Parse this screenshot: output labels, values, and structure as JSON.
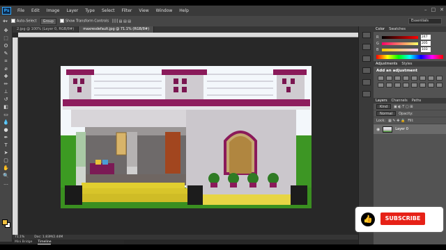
{
  "menubar": {
    "logo": "Ps",
    "items": [
      "File",
      "Edit",
      "Image",
      "Layer",
      "Type",
      "Select",
      "Filter",
      "View",
      "Window",
      "Help"
    ]
  },
  "options": {
    "auto_select_label": "Auto-Select",
    "auto_select_value": "Group",
    "transform_label": "Show Transform Controls",
    "workspace": "Essentials"
  },
  "tabs": [
    {
      "label": "2.jpg @ 100% (Layer 0, RGB/8#)"
    },
    {
      "label": "maxresdefault.jpg @ 71.1% (RGB/8#)"
    }
  ],
  "status": {
    "zoom": "71.1%",
    "doc": "Doc: 1.83M/2.44M"
  },
  "bottom_tabs": [
    "Mini Bridge",
    "Timeline"
  ],
  "color_panel": {
    "tabs": [
      "Color",
      "Swatches"
    ],
    "r": {
      "label": "R",
      "value": "247"
    },
    "g": {
      "label": "G",
      "value": "205"
    },
    "b": {
      "label": "B",
      "value": "103"
    }
  },
  "adjust_panel": {
    "tabs": [
      "Adjustments",
      "Styles"
    ],
    "title": "Add an adjustment"
  },
  "layers_panel": {
    "tabs": [
      "Layers",
      "Channels",
      "Paths"
    ],
    "kind": "Kind",
    "blend": "Normal",
    "opacity_label": "Opacity:",
    "lock_label": "Lock:",
    "fill_label": "Fill:",
    "layer_name": "Layer 0"
  },
  "overlay": {
    "subscribe": "SUBSCRIBE"
  },
  "colors": {
    "accent_magenta": "#8a1a5a",
    "foreground": "#f0c040",
    "subscribe_red": "#e62117"
  }
}
